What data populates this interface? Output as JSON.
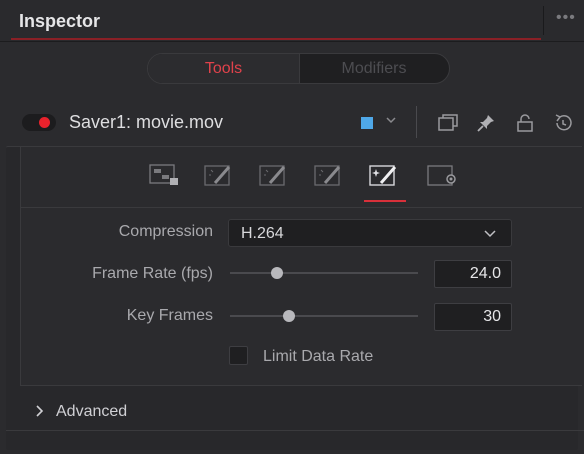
{
  "header": {
    "title": "Inspector",
    "menu_icon": "more-horizontal-icon"
  },
  "tabs": [
    {
      "label": "Tools",
      "active": true
    },
    {
      "label": "Modifiers",
      "active": false
    }
  ],
  "tool": {
    "enabled": true,
    "name": "Saver1: movie.mov",
    "color": "#4fa8e8",
    "header_icons": [
      "color-swatch-dropdown-icon",
      "view-mode-icon",
      "pin-icon",
      "lock-icon",
      "reset-icon"
    ]
  },
  "panel_tabs": [
    {
      "icon": "file-node-icon",
      "active": false
    },
    {
      "icon": "wand-icon",
      "active": false
    },
    {
      "icon": "wand-icon",
      "active": false
    },
    {
      "icon": "wand-icon",
      "active": false
    },
    {
      "icon": "magic-wand-icon",
      "active": true
    },
    {
      "icon": "settings-icon",
      "active": false
    }
  ],
  "form": {
    "compression": {
      "label": "Compression",
      "value": "H.264"
    },
    "frame_rate": {
      "label": "Frame Rate (fps)",
      "value": "24.0",
      "slider_fraction": 0.25
    },
    "key_frames": {
      "label": "Key Frames",
      "value": "30",
      "slider_fraction": 0.3
    },
    "limit_data_rate": {
      "label": "Limit Data Rate",
      "checked": false
    }
  },
  "advanced": {
    "label": "Advanced",
    "expanded": false
  },
  "colors": {
    "accent": "#e0424b",
    "record": "#e8222c",
    "swatch": "#4fa8e8"
  }
}
